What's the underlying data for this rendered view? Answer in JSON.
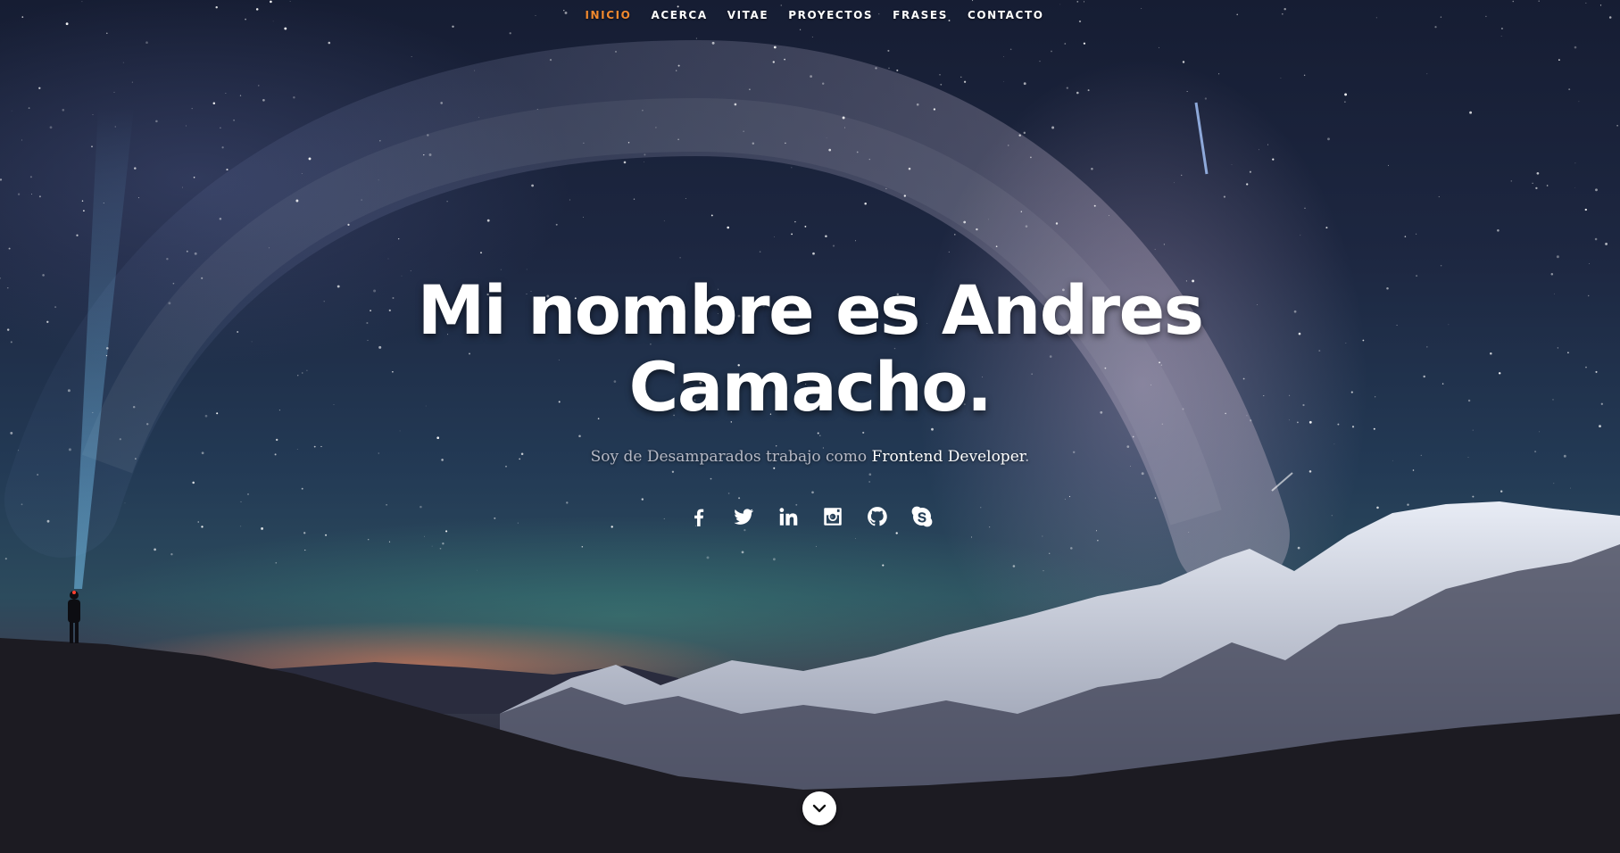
{
  "nav": {
    "items": [
      {
        "label": "Inicio",
        "active": true
      },
      {
        "label": "Acerca",
        "active": false
      },
      {
        "label": "Vitae",
        "active": false
      },
      {
        "label": "Proyectos",
        "active": false
      },
      {
        "label": "Frases",
        "active": false
      },
      {
        "label": "Contacto",
        "active": false
      }
    ],
    "active_color": "#f0892f"
  },
  "hero": {
    "headline_line1": "Mi nombre es Andres",
    "headline_line2": "Camacho.",
    "tagline_prefix": "Soy de Desamparados trabajo como",
    "tagline_role": "Frontend Developer",
    "tagline_suffix": "."
  },
  "social": [
    {
      "name": "facebook-icon"
    },
    {
      "name": "twitter-icon"
    },
    {
      "name": "linkedin-icon"
    },
    {
      "name": "instagram-icon"
    },
    {
      "name": "github-icon"
    },
    {
      "name": "skype-icon"
    }
  ],
  "scroll_down": {
    "icon": "chevron-down-icon"
  }
}
